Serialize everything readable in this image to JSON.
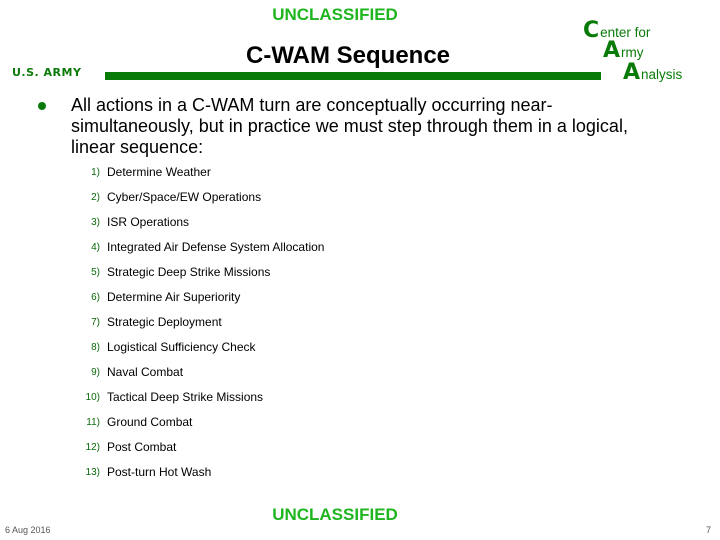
{
  "classification": {
    "top": "UNCLASSIFIED",
    "bottom": "UNCLASSIFIED",
    "color": "#1fb51f"
  },
  "header": {
    "title": "C-WAM Sequence",
    "army_label": "U.S. ARMY",
    "bar_color": "#077a07"
  },
  "logo": {
    "line1": {
      "initial": "C",
      "rest": "enter for"
    },
    "line2": {
      "initial": "A",
      "rest": "rmy"
    },
    "line3": {
      "initial": "A",
      "rest": "nalysis"
    }
  },
  "body": {
    "bullet": "All actions in a C-WAM turn are conceptually occurring near-simultaneously, but in practice we must step through them in a logical, linear sequence:",
    "bullet_icon": "filled-circle-bullet",
    "steps": [
      {
        "num": "1)",
        "label": "Determine Weather"
      },
      {
        "num": "2)",
        "label": "Cyber/Space/EW Operations"
      },
      {
        "num": "3)",
        "label": "ISR Operations"
      },
      {
        "num": "4)",
        "label": "Integrated Air Defense System Allocation"
      },
      {
        "num": "5)",
        "label": "Strategic Deep Strike Missions"
      },
      {
        "num": "6)",
        "label": "Determine Air Superiority"
      },
      {
        "num": "7)",
        "label": "Strategic Deployment"
      },
      {
        "num": "8)",
        "label": "Logistical Sufficiency Check"
      },
      {
        "num": "9)",
        "label": "Naval Combat"
      },
      {
        "num": "10)",
        "label": "Tactical Deep Strike Missions"
      },
      {
        "num": "11)",
        "label": "Ground Combat"
      },
      {
        "num": "12)",
        "label": "Post Combat"
      },
      {
        "num": "13)",
        "label": "Post-turn Hot Wash"
      }
    ]
  },
  "footer": {
    "date": "6 Aug 2016",
    "page": "7"
  }
}
